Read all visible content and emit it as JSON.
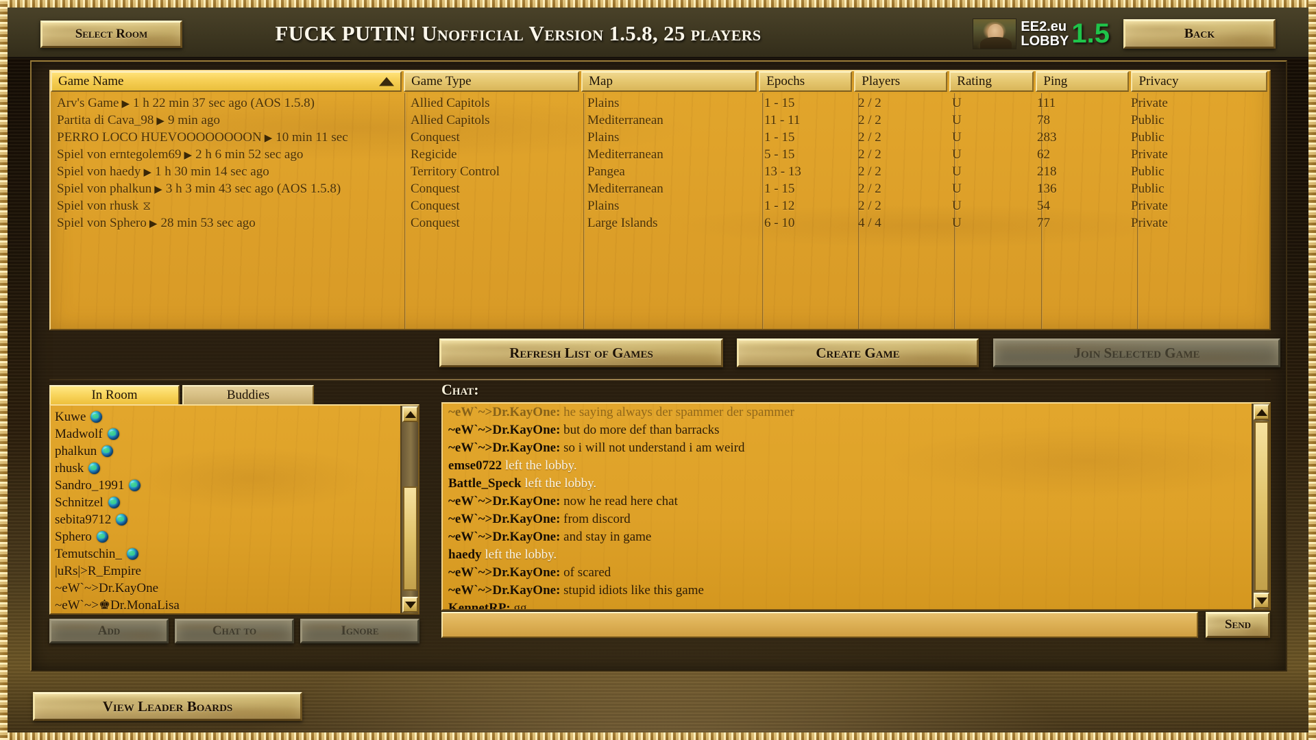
{
  "header": {
    "select_room_label": "Select Room",
    "title": "FUCK PUTIN! Unofficial Version 1.5.8, 25 players",
    "back_label": "Back",
    "logo": {
      "line1": "EE2.eu",
      "line2": "LOBBY",
      "version": "1.5",
      "version_color": "#1fc44a",
      "portrait": "mona-lisa-thumbnail"
    }
  },
  "games_table": {
    "columns": [
      "Game Name",
      "Game Type",
      "Map",
      "Epochs",
      "Players",
      "Rating",
      "Ping",
      "Privacy"
    ],
    "sorted_column": "Game Name",
    "sort_direction": "ascending",
    "rows": [
      {
        "name": "Arv's Game",
        "status_icon": "play",
        "age": "1 h 22 min 37 sec ago (AOS 1.5.8)",
        "type": "Allied Capitols",
        "map": "Plains",
        "epochs": "1 - 15",
        "players": "2 / 2",
        "rating": "U",
        "ping": "111",
        "privacy": "Private"
      },
      {
        "name": "Partita di Cava_98",
        "status_icon": "play",
        "age": "9 min ago",
        "type": "Allied Capitols",
        "map": "Mediterranean",
        "epochs": "11 - 11",
        "players": "2 / 2",
        "rating": "U",
        "ping": "78",
        "privacy": "Public"
      },
      {
        "name": "PERRO LOCO HUEVOOOOOOOON",
        "status_icon": "play",
        "age": "10 min 11 sec",
        "type": "Conquest",
        "map": "Plains",
        "epochs": "1 - 15",
        "players": "2 / 2",
        "rating": "U",
        "ping": "283",
        "privacy": "Public"
      },
      {
        "name": "Spiel von erntegolem69",
        "status_icon": "play",
        "age": "2 h 6 min 52 sec ago",
        "type": "Regicide",
        "map": "Mediterranean",
        "epochs": "5 - 15",
        "players": "2 / 2",
        "rating": "U",
        "ping": "62",
        "privacy": "Private"
      },
      {
        "name": "Spiel von haedy",
        "status_icon": "play",
        "age": "1 h 30 min 14 sec ago",
        "type": "Territory Control",
        "map": "Pangea",
        "epochs": "13 - 13",
        "players": "2 / 2",
        "rating": "U",
        "ping": "218",
        "privacy": "Public"
      },
      {
        "name": "Spiel von phalkun",
        "status_icon": "play",
        "age": "3 h 3 min 43 sec ago (AOS 1.5.8)",
        "type": "Conquest",
        "map": "Mediterranean",
        "epochs": "1 - 15",
        "players": "2 / 2",
        "rating": "U",
        "ping": "136",
        "privacy": "Public"
      },
      {
        "name": "Spiel von rhusk",
        "status_icon": "hourglass",
        "age": "",
        "type": "Conquest",
        "map": "Plains",
        "epochs": "1 - 12",
        "players": "2 / 2",
        "rating": "U",
        "ping": "54",
        "privacy": "Private"
      },
      {
        "name": "Spiel von Sphero",
        "status_icon": "play",
        "age": "28 min 53 sec ago",
        "type": "Conquest",
        "map": "Large Islands",
        "epochs": "6 - 10",
        "players": "4 / 4",
        "rating": "U",
        "ping": "77",
        "privacy": "Private"
      }
    ]
  },
  "actions": {
    "refresh_label": "Refresh List of Games",
    "create_label": "Create Game",
    "join_label": "Join Selected Game",
    "join_enabled": false
  },
  "player_panel": {
    "tabs": [
      {
        "label": "In Room",
        "active": true
      },
      {
        "label": "Buddies",
        "active": false
      }
    ],
    "players": [
      {
        "name": "Kuwe",
        "icon": "globe"
      },
      {
        "name": "Madwolf",
        "icon": "globe"
      },
      {
        "name": "phalkun",
        "icon": "globe"
      },
      {
        "name": "rhusk",
        "icon": "globe"
      },
      {
        "name": "Sandro_1991",
        "icon": "globe"
      },
      {
        "name": "Schnitzel",
        "icon": "globe"
      },
      {
        "name": "sebita9712",
        "icon": "globe"
      },
      {
        "name": "Sphero",
        "icon": "globe"
      },
      {
        "name": "Temutschin_",
        "icon": "globe"
      },
      {
        "name": "|uRs|>R_Empire",
        "icon": "none"
      },
      {
        "name": "~eW`~>Dr.KayOne",
        "icon": "none"
      },
      {
        "name": "~eW`~>♚Dr.MonaLisa",
        "icon": "none"
      }
    ],
    "buttons": [
      {
        "label": "Add",
        "enabled": false
      },
      {
        "label": "Chat to",
        "enabled": false
      },
      {
        "label": "Ignore",
        "enabled": false
      }
    ]
  },
  "chat_panel": {
    "label": "Chat:",
    "messages": [
      {
        "who": "~eW`~>Dr.KayOne",
        "sep": ": ",
        "msg": "he saying always der spammer der spammer",
        "system": false,
        "faded": true
      },
      {
        "who": "~eW`~>Dr.KayOne",
        "sep": ": ",
        "msg": "but do more def than barracks",
        "system": false,
        "faded": false
      },
      {
        "who": "~eW`~>Dr.KayOne",
        "sep": ": ",
        "msg": "so i will not understand i am weird",
        "system": false,
        "faded": false
      },
      {
        "who": "emse0722",
        "sep": " ",
        "msg": "left the lobby.",
        "system": true,
        "faded": false
      },
      {
        "who": "Battle_Speck",
        "sep": " ",
        "msg": "left the lobby.",
        "system": true,
        "faded": false
      },
      {
        "who": "~eW`~>Dr.KayOne",
        "sep": ": ",
        "msg": "now he read here  chat",
        "system": false,
        "faded": false
      },
      {
        "who": "~eW`~>Dr.KayOne",
        "sep": ": ",
        "msg": "from discord",
        "system": false,
        "faded": false
      },
      {
        "who": "~eW`~>Dr.KayOne",
        "sep": ": ",
        "msg": "and stay in game",
        "system": false,
        "faded": false
      },
      {
        "who": "haedy",
        "sep": " ",
        "msg": "left the lobby.",
        "system": true,
        "faded": false
      },
      {
        "who": "~eW`~>Dr.KayOne",
        "sep": ": ",
        "msg": "of scared",
        "system": false,
        "faded": false
      },
      {
        "who": "~eW`~>Dr.KayOne",
        "sep": ": ",
        "msg": "stupid idiots like this game",
        "system": false,
        "faded": false
      },
      {
        "who": "KennetRP",
        "sep": ": ",
        "msg": "gg",
        "system": false,
        "faded": false
      }
    ],
    "input_value": "",
    "input_placeholder": "",
    "send_label": "Send"
  },
  "footer": {
    "leaderboards_label": "View Leader Boards"
  }
}
